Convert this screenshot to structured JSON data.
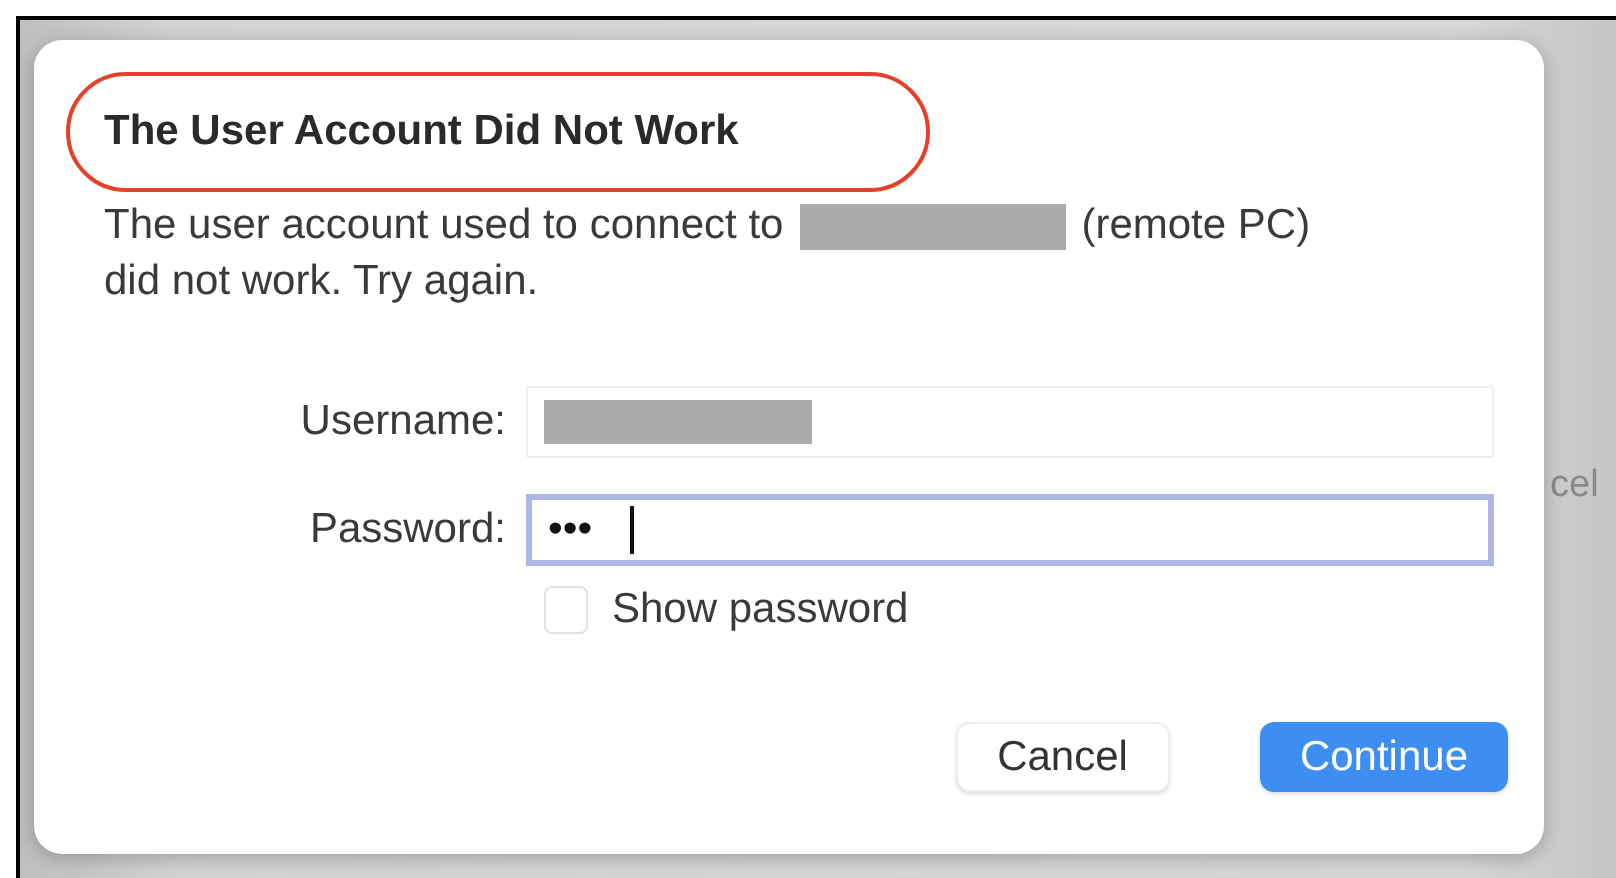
{
  "background": {
    "button_fragment": "cel"
  },
  "dialog": {
    "title": "The User Account Did Not Work",
    "message_before": "The user account used to connect to",
    "message_after": "(remote PC)",
    "message_line2": "did not work. Try again.",
    "fields": [
      {
        "label": "Username:",
        "kind": "redacted",
        "focused": false
      },
      {
        "label": "Password:",
        "kind": "password",
        "value": "•••",
        "focused": true
      }
    ],
    "show_password": {
      "label": "Show password",
      "checked": false
    },
    "buttons": [
      {
        "label": "Cancel",
        "primary": false
      },
      {
        "label": "Continue",
        "primary": true
      }
    ]
  }
}
